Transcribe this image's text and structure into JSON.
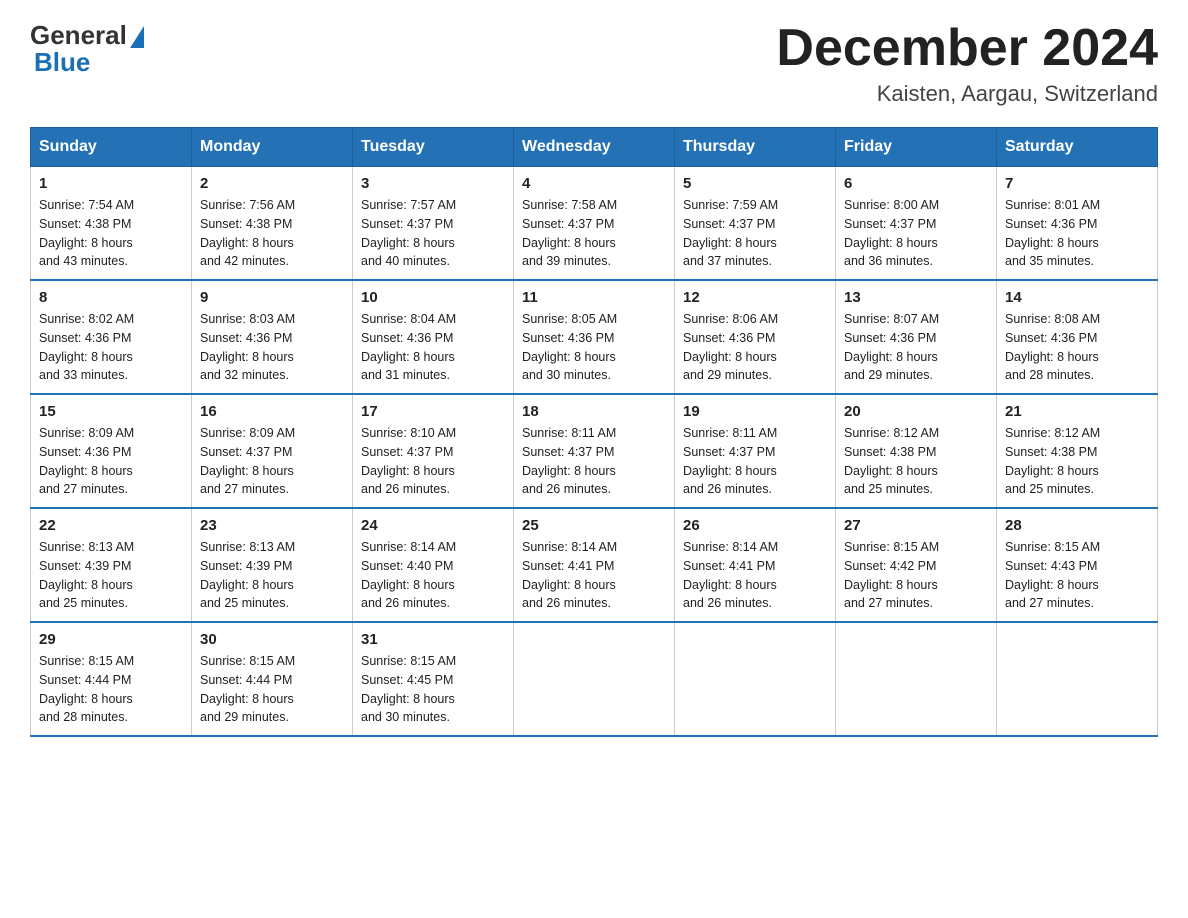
{
  "header": {
    "logo_general": "General",
    "logo_blue": "Blue",
    "month_title": "December 2024",
    "location": "Kaisten, Aargau, Switzerland"
  },
  "days_of_week": [
    "Sunday",
    "Monday",
    "Tuesday",
    "Wednesday",
    "Thursday",
    "Friday",
    "Saturday"
  ],
  "weeks": [
    [
      {
        "day": "1",
        "sunrise": "7:54 AM",
        "sunset": "4:38 PM",
        "daylight": "8 hours and 43 minutes."
      },
      {
        "day": "2",
        "sunrise": "7:56 AM",
        "sunset": "4:38 PM",
        "daylight": "8 hours and 42 minutes."
      },
      {
        "day": "3",
        "sunrise": "7:57 AM",
        "sunset": "4:37 PM",
        "daylight": "8 hours and 40 minutes."
      },
      {
        "day": "4",
        "sunrise": "7:58 AM",
        "sunset": "4:37 PM",
        "daylight": "8 hours and 39 minutes."
      },
      {
        "day": "5",
        "sunrise": "7:59 AM",
        "sunset": "4:37 PM",
        "daylight": "8 hours and 37 minutes."
      },
      {
        "day": "6",
        "sunrise": "8:00 AM",
        "sunset": "4:37 PM",
        "daylight": "8 hours and 36 minutes."
      },
      {
        "day": "7",
        "sunrise": "8:01 AM",
        "sunset": "4:36 PM",
        "daylight": "8 hours and 35 minutes."
      }
    ],
    [
      {
        "day": "8",
        "sunrise": "8:02 AM",
        "sunset": "4:36 PM",
        "daylight": "8 hours and 33 minutes."
      },
      {
        "day": "9",
        "sunrise": "8:03 AM",
        "sunset": "4:36 PM",
        "daylight": "8 hours and 32 minutes."
      },
      {
        "day": "10",
        "sunrise": "8:04 AM",
        "sunset": "4:36 PM",
        "daylight": "8 hours and 31 minutes."
      },
      {
        "day": "11",
        "sunrise": "8:05 AM",
        "sunset": "4:36 PM",
        "daylight": "8 hours and 30 minutes."
      },
      {
        "day": "12",
        "sunrise": "8:06 AM",
        "sunset": "4:36 PM",
        "daylight": "8 hours and 29 minutes."
      },
      {
        "day": "13",
        "sunrise": "8:07 AM",
        "sunset": "4:36 PM",
        "daylight": "8 hours and 29 minutes."
      },
      {
        "day": "14",
        "sunrise": "8:08 AM",
        "sunset": "4:36 PM",
        "daylight": "8 hours and 28 minutes."
      }
    ],
    [
      {
        "day": "15",
        "sunrise": "8:09 AM",
        "sunset": "4:36 PM",
        "daylight": "8 hours and 27 minutes."
      },
      {
        "day": "16",
        "sunrise": "8:09 AM",
        "sunset": "4:37 PM",
        "daylight": "8 hours and 27 minutes."
      },
      {
        "day": "17",
        "sunrise": "8:10 AM",
        "sunset": "4:37 PM",
        "daylight": "8 hours and 26 minutes."
      },
      {
        "day": "18",
        "sunrise": "8:11 AM",
        "sunset": "4:37 PM",
        "daylight": "8 hours and 26 minutes."
      },
      {
        "day": "19",
        "sunrise": "8:11 AM",
        "sunset": "4:37 PM",
        "daylight": "8 hours and 26 minutes."
      },
      {
        "day": "20",
        "sunrise": "8:12 AM",
        "sunset": "4:38 PM",
        "daylight": "8 hours and 25 minutes."
      },
      {
        "day": "21",
        "sunrise": "8:12 AM",
        "sunset": "4:38 PM",
        "daylight": "8 hours and 25 minutes."
      }
    ],
    [
      {
        "day": "22",
        "sunrise": "8:13 AM",
        "sunset": "4:39 PM",
        "daylight": "8 hours and 25 minutes."
      },
      {
        "day": "23",
        "sunrise": "8:13 AM",
        "sunset": "4:39 PM",
        "daylight": "8 hours and 25 minutes."
      },
      {
        "day": "24",
        "sunrise": "8:14 AM",
        "sunset": "4:40 PM",
        "daylight": "8 hours and 26 minutes."
      },
      {
        "day": "25",
        "sunrise": "8:14 AM",
        "sunset": "4:41 PM",
        "daylight": "8 hours and 26 minutes."
      },
      {
        "day": "26",
        "sunrise": "8:14 AM",
        "sunset": "4:41 PM",
        "daylight": "8 hours and 26 minutes."
      },
      {
        "day": "27",
        "sunrise": "8:15 AM",
        "sunset": "4:42 PM",
        "daylight": "8 hours and 27 minutes."
      },
      {
        "day": "28",
        "sunrise": "8:15 AM",
        "sunset": "4:43 PM",
        "daylight": "8 hours and 27 minutes."
      }
    ],
    [
      {
        "day": "29",
        "sunrise": "8:15 AM",
        "sunset": "4:44 PM",
        "daylight": "8 hours and 28 minutes."
      },
      {
        "day": "30",
        "sunrise": "8:15 AM",
        "sunset": "4:44 PM",
        "daylight": "8 hours and 29 minutes."
      },
      {
        "day": "31",
        "sunrise": "8:15 AM",
        "sunset": "4:45 PM",
        "daylight": "8 hours and 30 minutes."
      },
      {
        "day": "",
        "sunrise": "",
        "sunset": "",
        "daylight": ""
      },
      {
        "day": "",
        "sunrise": "",
        "sunset": "",
        "daylight": ""
      },
      {
        "day": "",
        "sunrise": "",
        "sunset": "",
        "daylight": ""
      },
      {
        "day": "",
        "sunrise": "",
        "sunset": "",
        "daylight": ""
      }
    ]
  ]
}
